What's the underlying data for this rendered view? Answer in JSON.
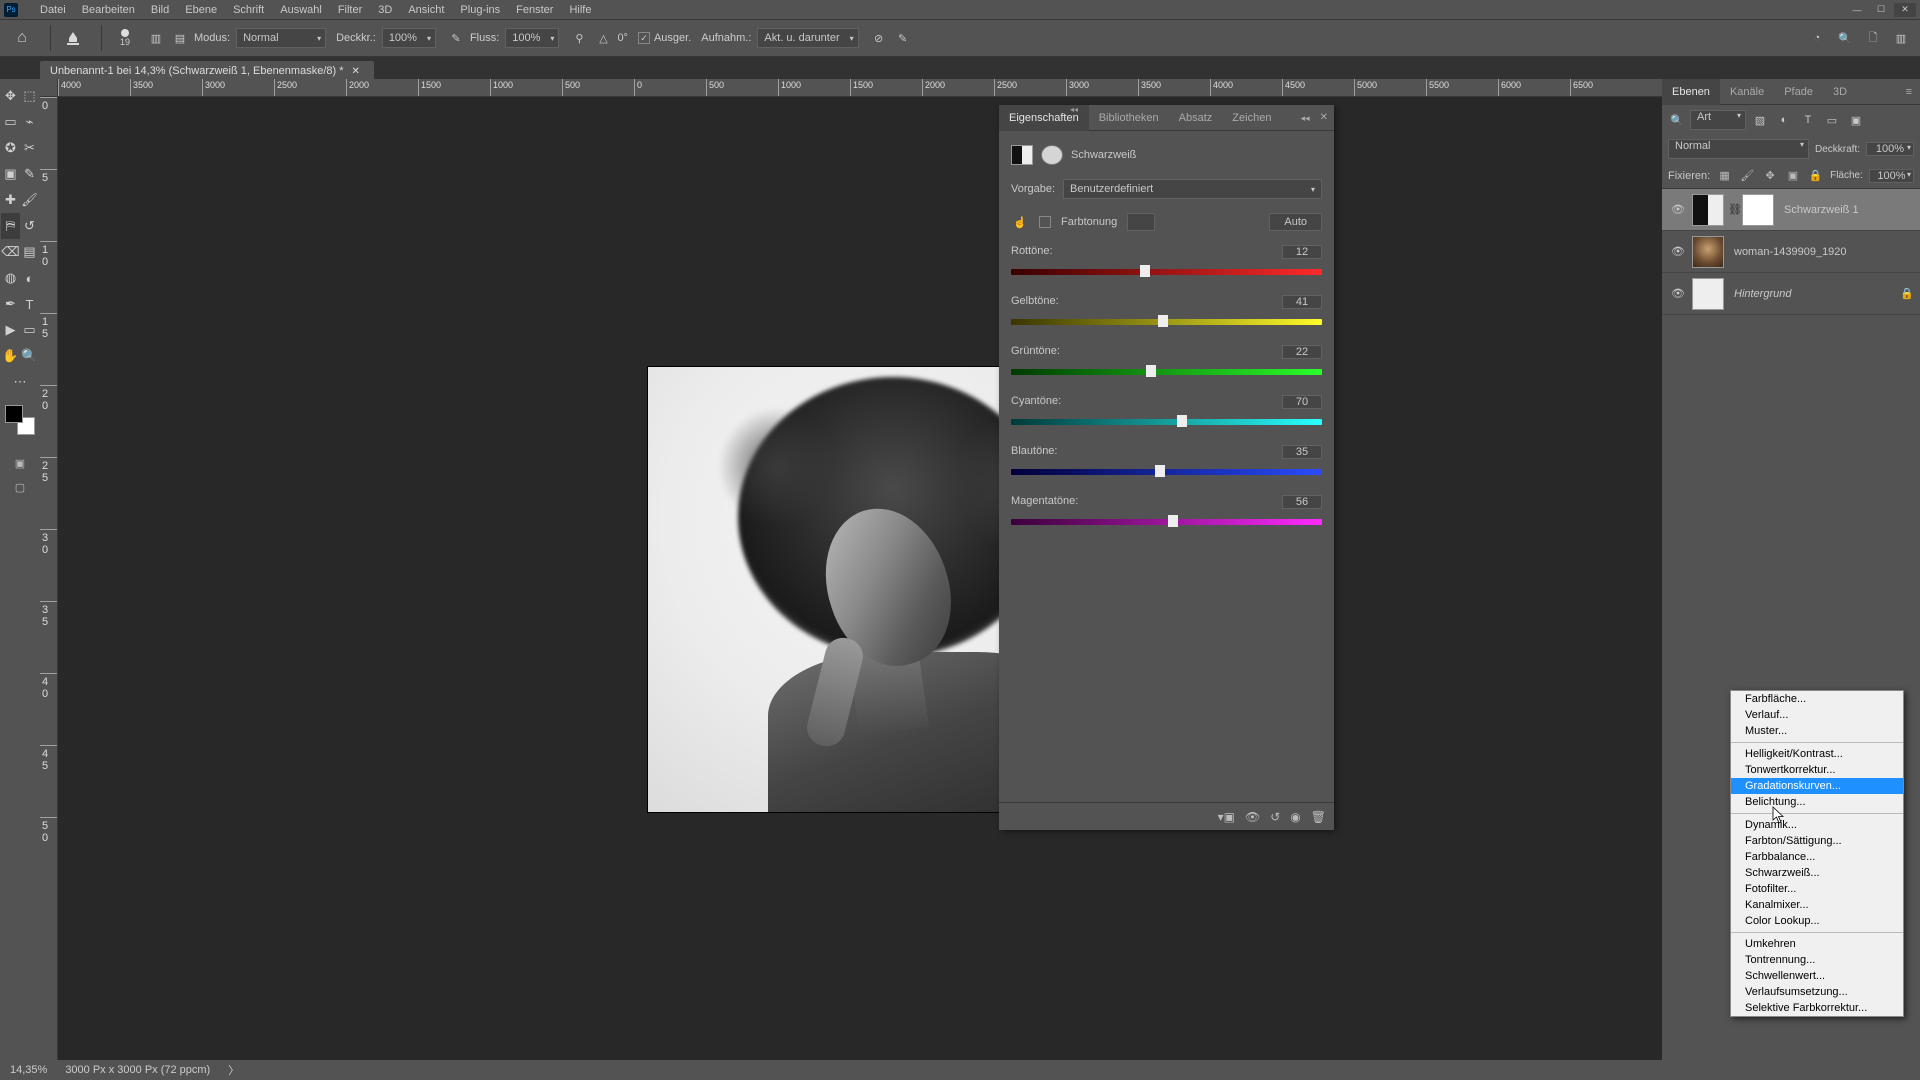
{
  "title_bar": {
    "logo": "Ps"
  },
  "menu": [
    "Datei",
    "Bearbeiten",
    "Bild",
    "Ebene",
    "Schrift",
    "Auswahl",
    "Filter",
    "3D",
    "Ansicht",
    "Plug-ins",
    "Fenster",
    "Hilfe"
  ],
  "options": {
    "brush_size": "19",
    "mode_label": "Modus:",
    "mode_value": "Normal",
    "opacity_label": "Deckkr.:",
    "opacity_value": "100%",
    "flow_label": "Fluss:",
    "flow_value": "100%",
    "angle_glyph": "△",
    "angle_value": "0°",
    "aligned_label": "Ausger.",
    "sample_label": "Aufnahm.:",
    "sample_value": "Akt. u. darunter"
  },
  "doc_tab": "Unbenannt-1 bei 14,3% (Schwarzweiß 1, Ebenenmaske/8) *",
  "ruler_h": [
    "4000",
    "3500",
    "3000",
    "2500",
    "2000",
    "1500",
    "1000",
    "500",
    "0",
    "500",
    "1000",
    "1500",
    "2000",
    "2500",
    "3000",
    "3500",
    "4000",
    "4500",
    "5000",
    "5500",
    "6000",
    "6500"
  ],
  "ruler_v": [
    "0",
    "5",
    "1 0",
    "1 5",
    "2 0",
    "2 5",
    "3 0",
    "3 5",
    "4 0",
    "4 5",
    "5 0"
  ],
  "prop_tabs": [
    "Eigenschaften",
    "Bibliotheken",
    "Absatz",
    "Zeichen"
  ],
  "adjustment": {
    "title": "Schwarzweiß",
    "preset_label": "Vorgabe:",
    "preset_value": "Benutzerdefiniert",
    "tint_label": "Farbtonung",
    "auto_label": "Auto",
    "sliders": [
      {
        "label": "Rottöne:",
        "value": "12",
        "class": "red",
        "pos": 43
      },
      {
        "label": "Gelbtöne:",
        "value": "41",
        "class": "yellow",
        "pos": 49
      },
      {
        "label": "Grüntöne:",
        "value": "22",
        "class": "green",
        "pos": 45
      },
      {
        "label": "Cyantöne:",
        "value": "70",
        "class": "cyan",
        "pos": 55
      },
      {
        "label": "Blautöne:",
        "value": "35",
        "class": "blue",
        "pos": 48
      },
      {
        "label": "Magentatöne:",
        "value": "56",
        "class": "magenta",
        "pos": 52
      }
    ]
  },
  "layers_tabs": [
    "Ebenen",
    "Kanäle",
    "Pfade",
    "3D"
  ],
  "filter_label": "Art",
  "blend_row": {
    "mode": "Normal",
    "opacity_label": "Deckkraft:",
    "opacity_value": "100%"
  },
  "lock_row": {
    "label": "Fixieren:",
    "fill_label": "Fläche:",
    "fill_value": "100%"
  },
  "layers": [
    {
      "name": "Schwarzweiß 1",
      "kind": "adj",
      "selected": true,
      "locked": false
    },
    {
      "name": "woman-1439909_1920",
      "kind": "photo",
      "selected": false,
      "locked": false
    },
    {
      "name": "Hintergrund",
      "kind": "bg",
      "selected": false,
      "locked": true,
      "italic": true
    }
  ],
  "context_menu": {
    "groups": [
      [
        "Farbfläche...",
        "Verlauf...",
        "Muster..."
      ],
      [
        "Helligkeit/Kontrast...",
        "Tonwertkorrektur...",
        "Gradationskurven...",
        "Belichtung..."
      ],
      [
        "Dynamik...",
        "Farbton/Sättigung...",
        "Farbbalance...",
        "Schwarzweiß...",
        "Fotofilter...",
        "Kanalmixer...",
        "Color Lookup..."
      ],
      [
        "Umkehren",
        "Tontrennung...",
        "Schwellenwert...",
        "Verlaufsumsetzung...",
        "Selektive Farbkorrektur..."
      ]
    ],
    "highlight": "Gradationskurven..."
  },
  "status": {
    "zoom": "14,35%",
    "info": "3000 Px x 3000 Px (72 ppcm)"
  }
}
